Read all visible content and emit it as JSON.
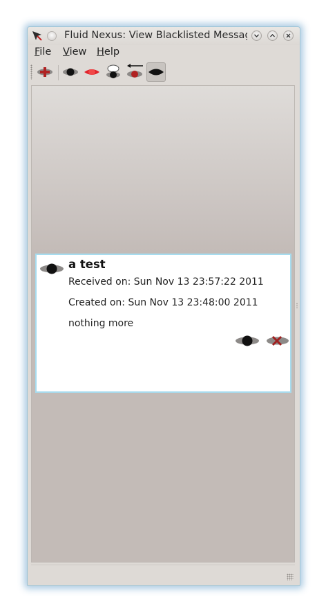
{
  "window": {
    "title": "Fluid Nexus: View Blacklisted Messag...",
    "controls": [
      "minimize",
      "maximize",
      "close"
    ]
  },
  "menu": [
    {
      "mnemonic": "F",
      "rest": "ile"
    },
    {
      "mnemonic": "V",
      "rest": "iew"
    },
    {
      "mnemonic": "H",
      "rest": "elp"
    }
  ],
  "toolbar": {
    "icons": [
      "add-message-icon",
      "view-all-icon",
      "view-outgoing-icon",
      "view-public-icon",
      "view-received-icon",
      "view-blacklisted-icon"
    ],
    "active": "view-blacklisted-icon"
  },
  "message": {
    "title": "a test",
    "received": "Received on: Sun Nov 13 23:57:22 2011",
    "created": "Created on: Sun Nov 13 23:48:00 2011",
    "body": "nothing more",
    "actions": [
      "unblacklist-icon",
      "delete-icon"
    ]
  },
  "colors": {
    "accent_red": "#e0222a",
    "delete_red": "#a02020",
    "card_border": "#a6dcef"
  }
}
